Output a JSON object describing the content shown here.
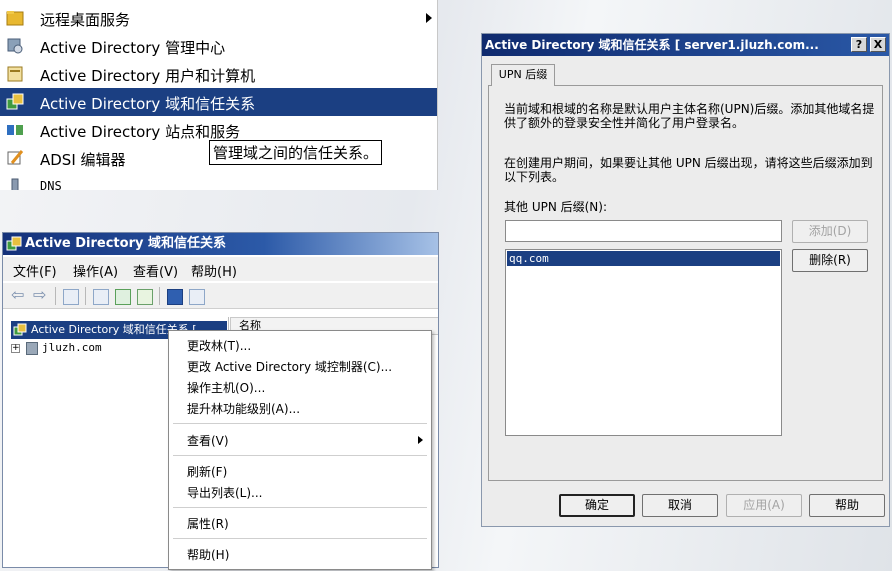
{
  "start_menu": {
    "items": [
      {
        "label": "远程桌面服务",
        "icon": "folder-icon",
        "has_submenu": true
      },
      {
        "label": "Active Directory 管理中心",
        "icon": "ad-admin-center-icon"
      },
      {
        "label": "Active Directory 用户和计算机",
        "icon": "ad-users-computers-icon"
      },
      {
        "label": "Active Directory 域和信任关系",
        "icon": "ad-domains-trusts-icon",
        "selected": true
      },
      {
        "label": "Active Directory 站点和服务",
        "icon": "ad-sites-services-icon"
      },
      {
        "label": "ADSI 编辑器",
        "icon": "adsi-edit-icon"
      },
      {
        "label": "DNS",
        "icon": "dns-icon"
      }
    ],
    "tooltip": "管理域之间的信任关系。"
  },
  "mmc": {
    "title": "Active Directory 域和信任关系",
    "menu": [
      "文件(F)",
      "操作(A)",
      "查看(V)",
      "帮助(H)"
    ],
    "tree_root": "Active Directory 域和信任关系 [",
    "tree_child": "jluzh.com",
    "column_header": "名称",
    "toolbar_icons": [
      "back-icon",
      "forward-icon",
      "console-tree-icon",
      "properties-icon",
      "refresh-icon",
      "export-icon",
      "help-icon",
      "show-hide-icon"
    ]
  },
  "context_menu": {
    "items": [
      "更改林(T)...",
      "更改 Active Directory 域控制器(C)...",
      "操作主机(O)...",
      "提升林功能级别(A)...",
      "查看(V)",
      "刷新(F)",
      "导出列表(L)...",
      "属性(R)",
      "帮助(H)"
    ]
  },
  "dialog": {
    "title": "Active Directory 域和信任关系 [ server1.jluzh.com... ",
    "help_btn": "?",
    "close_btn": "X",
    "tab": "UPN 后缀",
    "desc1": "当前域和根域的名称是默认用户主体名称(UPN)后缀。添加其他域名提供了额外的登录安全性并简化了用户登录名。",
    "desc2": "在创建用户期间，如果要让其他 UPN 后缀出现，请将这些后缀添加到以下列表。",
    "field_label": "其他 UPN 后缀(N):",
    "input_value": "",
    "add_btn": "添加(D)",
    "remove_btn": "删除(R)",
    "list_items": [
      "qq.com"
    ],
    "ok_btn": "确定",
    "cancel_btn": "取消",
    "apply_btn": "应用(A)",
    "help_button": "帮助"
  },
  "colors": {
    "selection": "#1b3f82",
    "title_bar": "#14317a"
  }
}
